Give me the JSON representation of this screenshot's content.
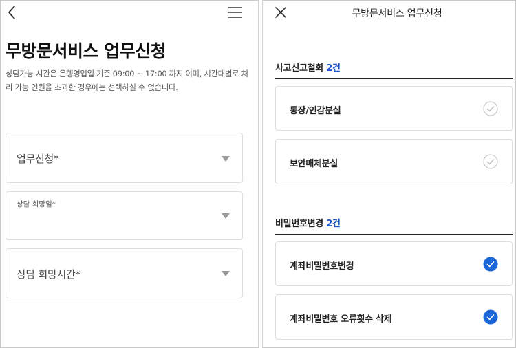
{
  "left": {
    "title": "무방문서비스 업무신청",
    "notice": "상담가능 시간은 은행영업일 기준 09:00 ~ 17:00 까지 이며, 시간대별로 처리 가능 인원을 초과한 경우에는 선택하실 수 없습니다.",
    "fields": [
      {
        "label": "업무신청*"
      },
      {
        "label": "상담 희망일*"
      },
      {
        "label": "상담 희망시간*"
      }
    ],
    "icons": {
      "back": "chevron-left-icon",
      "menu": "hamburger-menu-icon",
      "dropdown": "triangle-down-icon"
    }
  },
  "right": {
    "header_title": "무방문서비스 업무신청",
    "sections": [
      {
        "title": "사고신고철회",
        "count": "2건",
        "items": [
          {
            "label": "통장/인감분실",
            "checked": false
          },
          {
            "label": "보안매체분실",
            "checked": false
          }
        ]
      },
      {
        "title": "비밀번호변경",
        "count": "2건",
        "items": [
          {
            "label": "계좌비밀번호변경",
            "checked": true
          },
          {
            "label": "계좌비밀번호 오류횟수 삭제",
            "checked": true
          }
        ]
      }
    ],
    "icons": {
      "close": "close-icon",
      "check": "check-circle-icon"
    }
  },
  "colors": {
    "accent": "#1a56c4",
    "check_active": "#1a66d6",
    "check_inactive": "#bdbdbd",
    "border": "#dedede"
  }
}
